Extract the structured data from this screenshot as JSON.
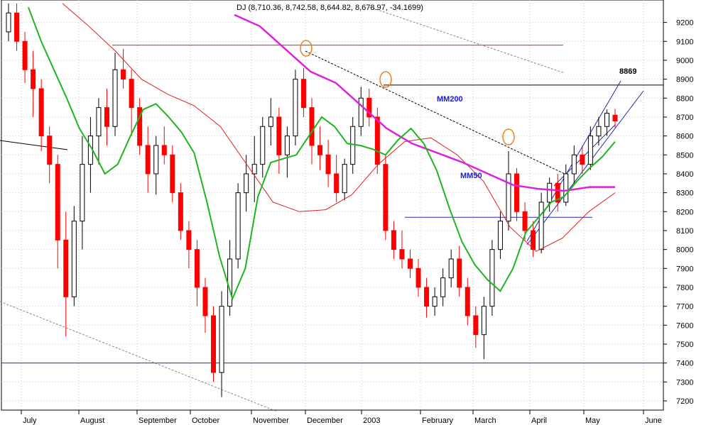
{
  "header": {
    "quote": "DJ (8,710.36, 8,742.58, 8,644.82, 8,678.97, -34.1699)"
  },
  "chart_data": {
    "type": "candlestick",
    "title": "DJ (8,710.36, 8,742.58, 8,644.82, 8,678.97, -34.1699)",
    "ylim": [
      7150,
      9300
    ],
    "y_ticks": [
      7200,
      7300,
      7400,
      7500,
      7600,
      7700,
      7800,
      7900,
      8000,
      8100,
      8200,
      8300,
      8400,
      8500,
      8600,
      8700,
      8800,
      8900,
      9000,
      9100,
      9200
    ],
    "x_ticks": [
      "July",
      "August",
      "September",
      "October",
      "November",
      "December",
      "2003",
      "February",
      "March",
      "April",
      "May",
      "June"
    ],
    "grid": true,
    "colors": {
      "up_candle": "#000000",
      "down_candle": "#ff0000",
      "mm50": "#1fb51f",
      "mm200": "#dd22dd",
      "slow_ma": "#e02020",
      "levels": "#2828b0",
      "markers": "#f08020"
    },
    "series": [
      {
        "name": "MM50",
        "label_color": "#1a1ad0",
        "values": [
          9280,
          9100,
          8950,
          8800,
          8640,
          8530,
          8400,
          8450,
          8600,
          8740,
          8770,
          8700,
          8620,
          8510,
          8250,
          7960,
          7740,
          7900,
          8280,
          8460,
          8480,
          8500,
          8600,
          8700,
          8650,
          8560,
          8550,
          8530,
          8500,
          8580,
          8640,
          8560,
          8420,
          8220,
          8040,
          7920,
          7840,
          7780,
          7900,
          8090,
          8170,
          8250,
          8280,
          8360,
          8430,
          8490,
          8570
        ]
      },
      {
        "name": "MM200",
        "label_color": "#1a1ad0",
        "values": [
          9240,
          9180,
          9060,
          8940,
          8880,
          8760,
          8640,
          8560,
          8510,
          8460,
          8400,
          8340,
          8320,
          8310,
          8330,
          8330
        ]
      },
      {
        "name": "slow-ma",
        "values": [
          9300,
          9180,
          9050,
          8900,
          8820,
          8760,
          8650,
          8450,
          8250,
          8200,
          8210,
          8290,
          8450,
          8570,
          8590,
          8500,
          8360,
          8120,
          7990,
          8060,
          8200,
          8300
        ]
      }
    ],
    "candles": [
      [
        9150,
        9300,
        9100,
        9250
      ],
      [
        9250,
        9300,
        9050,
        9100
      ],
      [
        9100,
        9150,
        8880,
        8950
      ],
      [
        8950,
        9050,
        8700,
        8850
      ],
      [
        8850,
        8900,
        8520,
        8600
      ],
      [
        8600,
        8650,
        8350,
        8450
      ],
      [
        8450,
        8500,
        7900,
        8050
      ],
      [
        8050,
        8200,
        7540,
        7750
      ],
      [
        7750,
        8230,
        7700,
        8150
      ],
      [
        8150,
        8600,
        8000,
        8450
      ],
      [
        8450,
        8700,
        8300,
        8600
      ],
      [
        8600,
        8800,
        8450,
        8750
      ],
      [
        8750,
        8850,
        8550,
        8650
      ],
      [
        8650,
        9040,
        8600,
        8950
      ],
      [
        8950,
        9060,
        8850,
        8900
      ],
      [
        8900,
        8950,
        8600,
        8750
      ],
      [
        8750,
        8800,
        8500,
        8550
      ],
      [
        8550,
        8650,
        8300,
        8400
      ],
      [
        8400,
        8600,
        8290,
        8550
      ],
      [
        8550,
        8650,
        8450,
        8500
      ],
      [
        8500,
        8550,
        8250,
        8300
      ],
      [
        8300,
        8350,
        8050,
        8100
      ],
      [
        8100,
        8150,
        7900,
        8000
      ],
      [
        8000,
        8050,
        7700,
        7800
      ],
      [
        7800,
        7850,
        7560,
        7650
      ],
      [
        7650,
        7700,
        7300,
        7350
      ],
      [
        7350,
        7780,
        7220,
        7700
      ],
      [
        7700,
        8050,
        7650,
        7950
      ],
      [
        7950,
        8350,
        7900,
        8300
      ],
      [
        8300,
        8500,
        8200,
        8400
      ],
      [
        8400,
        8600,
        8250,
        8450
      ],
      [
        8450,
        8700,
        8380,
        8650
      ],
      [
        8650,
        8800,
        8550,
        8700
      ],
      [
        8700,
        8750,
        8400,
        8500
      ],
      [
        8500,
        8650,
        8380,
        8600
      ],
      [
        8600,
        8950,
        8550,
        8900
      ],
      [
        8900,
        8960,
        8700,
        8750
      ],
      [
        8750,
        8800,
        8450,
        8550
      ],
      [
        8550,
        8650,
        8420,
        8500
      ],
      [
        8500,
        8580,
        8330,
        8400
      ],
      [
        8400,
        8500,
        8250,
        8300
      ],
      [
        8300,
        8480,
        8260,
        8450
      ],
      [
        8450,
        8700,
        8400,
        8650
      ],
      [
        8650,
        8860,
        8600,
        8800
      ],
      [
        8800,
        8850,
        8650,
        8700
      ],
      [
        8700,
        8750,
        8400,
        8450
      ],
      [
        8450,
        8500,
        8050,
        8100
      ],
      [
        8100,
        8150,
        7950,
        8000
      ],
      [
        8000,
        8100,
        7900,
        7950
      ],
      [
        7950,
        8000,
        7850,
        7900
      ],
      [
        7900,
        7950,
        7750,
        7800
      ],
      [
        7800,
        7850,
        7640,
        7700
      ],
      [
        7700,
        7800,
        7650,
        7750
      ],
      [
        7750,
        7900,
        7700,
        7850
      ],
      [
        7850,
        8000,
        7800,
        7950
      ],
      [
        7950,
        8020,
        7750,
        7800
      ],
      [
        7800,
        7850,
        7600,
        7650
      ],
      [
        7650,
        7700,
        7480,
        7550
      ],
      [
        7550,
        7750,
        7420,
        7700
      ],
      [
        7700,
        8050,
        7650,
        8000
      ],
      [
        8000,
        8200,
        7950,
        8150
      ],
      [
        8150,
        8520,
        8100,
        8400
      ],
      [
        8400,
        8430,
        8150,
        8200
      ],
      [
        8200,
        8250,
        8050,
        8100
      ],
      [
        8100,
        8150,
        7960,
        8000
      ],
      [
        8000,
        8300,
        7980,
        8250
      ],
      [
        8250,
        8380,
        8200,
        8350
      ],
      [
        8350,
        8400,
        8200,
        8250
      ],
      [
        8250,
        8450,
        8230,
        8400
      ],
      [
        8400,
        8550,
        8350,
        8500
      ],
      [
        8500,
        8550,
        8400,
        8450
      ],
      [
        8450,
        8650,
        8420,
        8600
      ],
      [
        8600,
        8700,
        8550,
        8650
      ],
      [
        8650,
        8740,
        8600,
        8720
      ],
      [
        8710,
        8743,
        8645,
        8679
      ]
    ],
    "annotations": [
      {
        "text": "8869",
        "type": "horizontal-line",
        "value": 8869
      },
      {
        "text": "MM200",
        "target_series": "MM200"
      },
      {
        "text": "MM50",
        "target_series": "MM50"
      }
    ],
    "horizontal_levels": [
      9080,
      8869,
      8170,
      7400
    ],
    "markers": [
      {
        "type": "circle",
        "near_value": 9060
      },
      {
        "type": "circle",
        "near_value": 8860
      },
      {
        "type": "circle",
        "near_value": 8520
      }
    ]
  }
}
